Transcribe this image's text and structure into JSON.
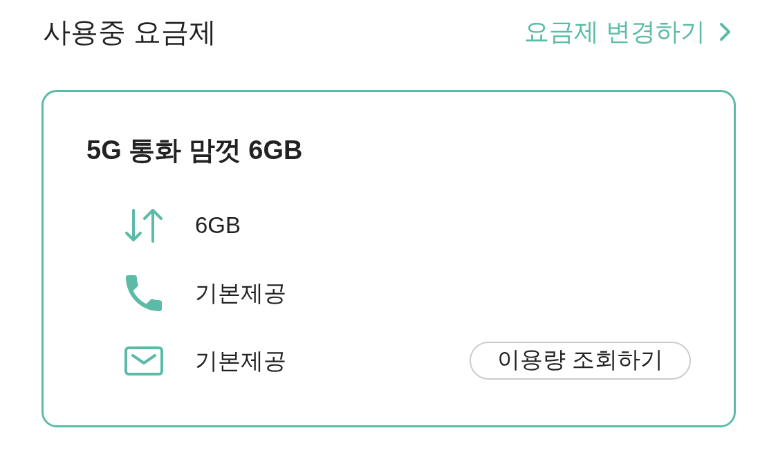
{
  "header": {
    "title": "사용중 요금제",
    "change_link": {
      "label": "요금제 변경하기"
    }
  },
  "plan": {
    "name": "5G 통화 맘껏 6GB",
    "allowances": [
      {
        "kind": "data",
        "value": "6GB"
      },
      {
        "kind": "voice",
        "value": "기본제공"
      },
      {
        "kind": "sms",
        "value": "기본제공"
      }
    ],
    "usage_button": {
      "label": "이용량 조회하기"
    }
  }
}
